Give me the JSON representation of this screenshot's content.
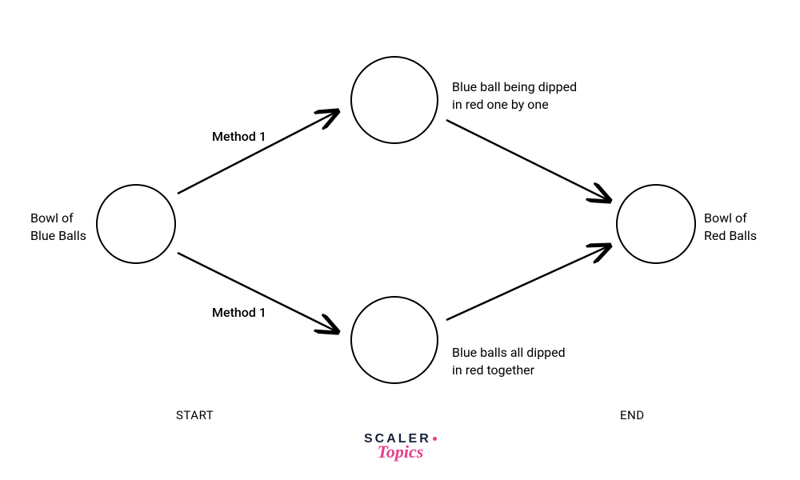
{
  "nodes": {
    "start": {
      "label": "Bowl of\nBlue Balls"
    },
    "top": {
      "label": "Blue ball being dipped\nin red one by one"
    },
    "bottom": {
      "label": "Blue balls all dipped\nin red together"
    },
    "end": {
      "label": "Bowl of\nRed Balls"
    }
  },
  "edges": {
    "method_top": "Method 1",
    "method_bottom": "Method 1"
  },
  "footer": {
    "start": "START",
    "end": "END"
  },
  "brand": {
    "line1": "SCALER",
    "line2": "Topics"
  }
}
